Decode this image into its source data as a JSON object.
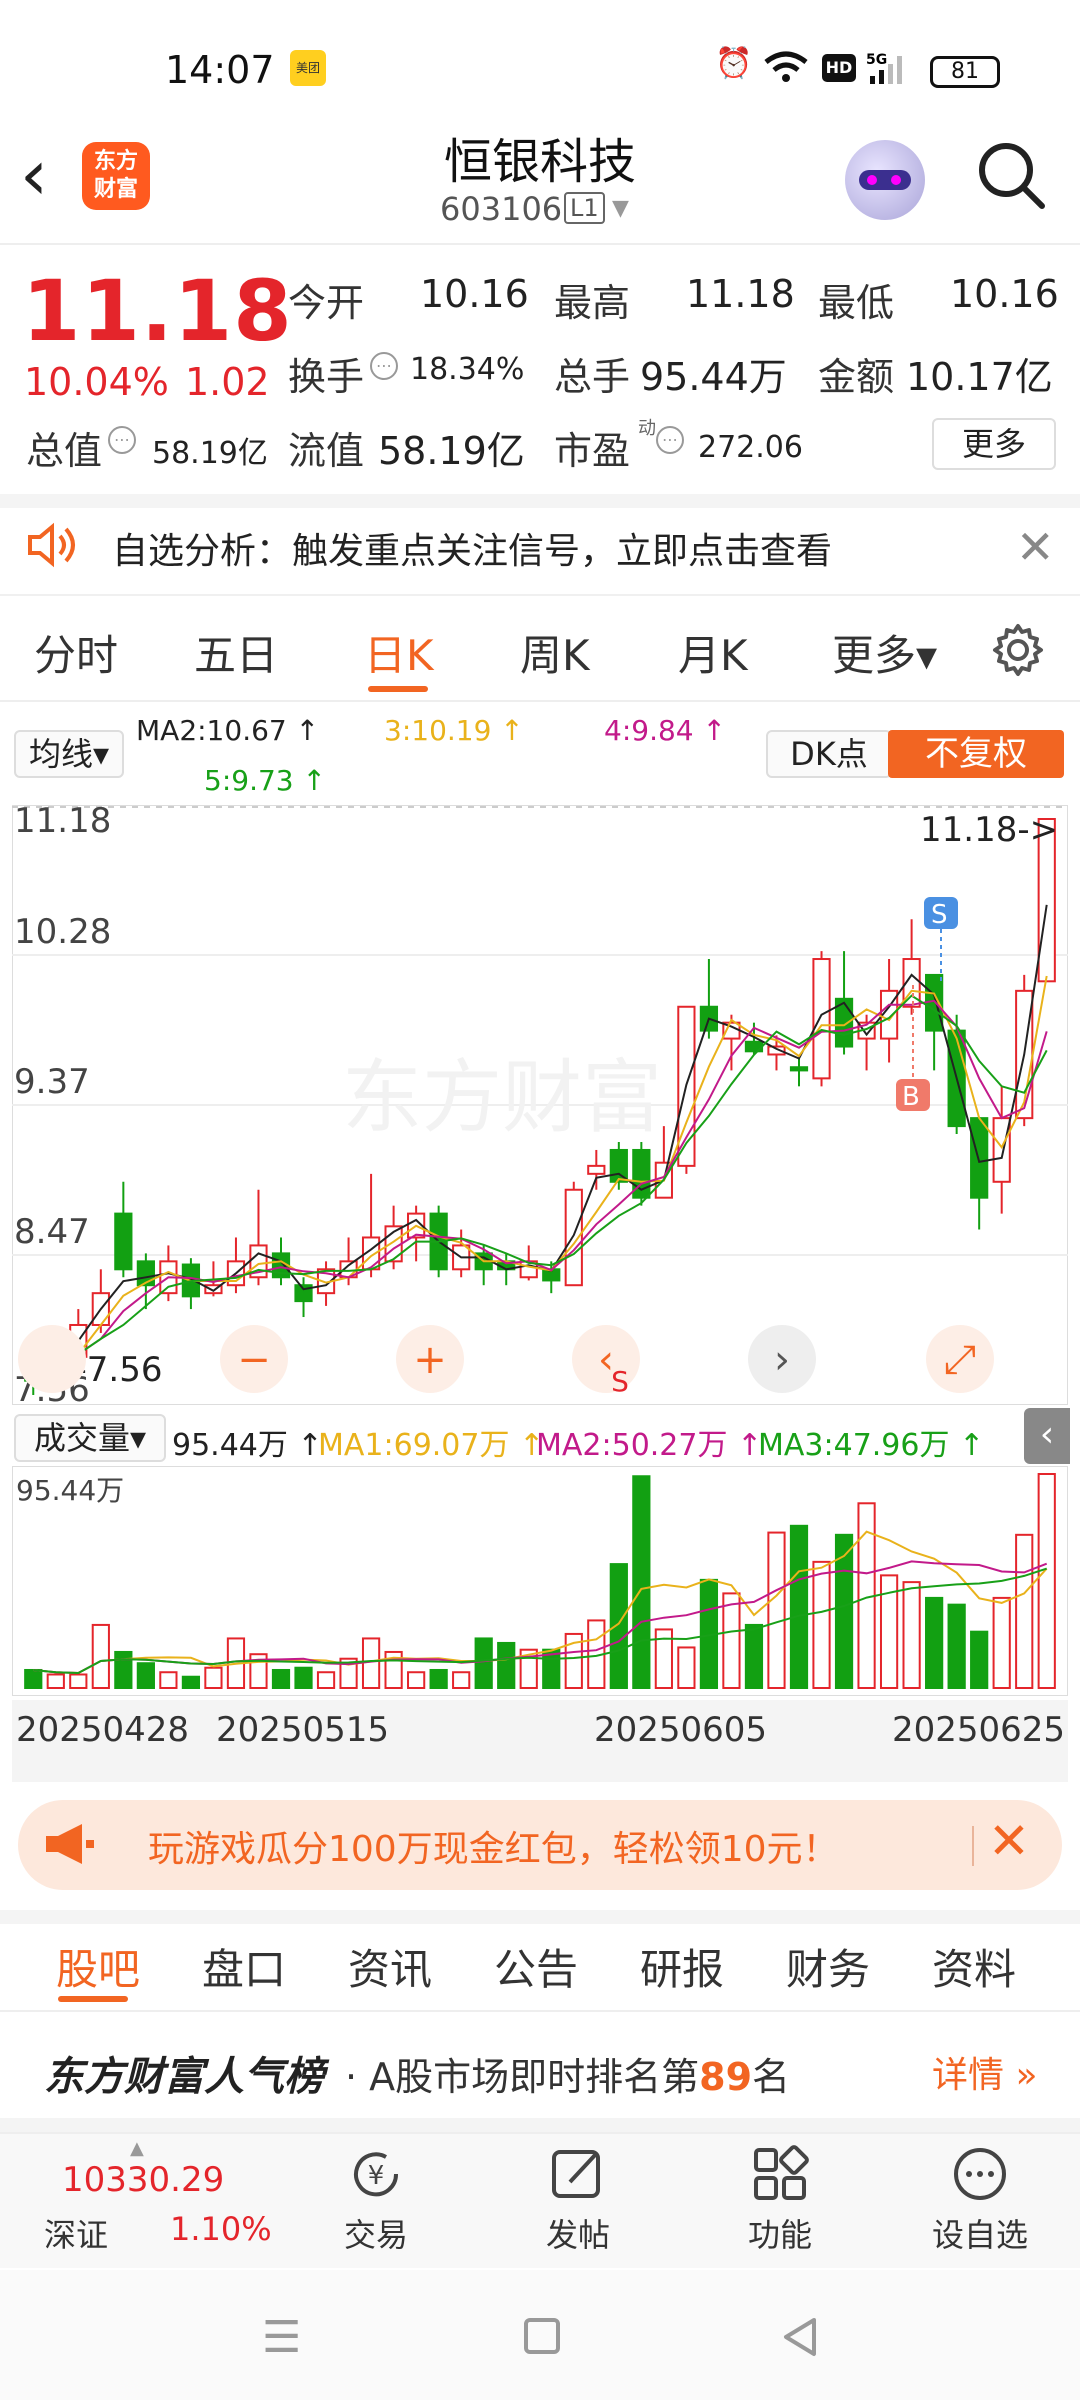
{
  "status_bar": {
    "time": "14:07",
    "app_badge": "美团",
    "battery": "81"
  },
  "header": {
    "back": "‹",
    "logo": "东方\n财富",
    "stock_name": "恒银科技",
    "stock_code": "603106",
    "level": "L1"
  },
  "quote": {
    "price": "11.18",
    "change_pct": "10.04%",
    "change": "1.02",
    "open_label": "今开",
    "open": "10.16",
    "high_label": "最高",
    "high": "11.18",
    "low_label": "最低",
    "low": "10.16",
    "turnover_label": "换手",
    "turnover": "18.34%",
    "volume_label": "总手",
    "volume": "95.44万",
    "amount_label": "金额",
    "amount": "10.17亿",
    "mktcap_label": "总值",
    "mktcap": "58.19亿",
    "float_label": "流值",
    "float_cap": "58.19亿",
    "pe_label": "市盈",
    "pe_sup": "动",
    "pe": "272.06",
    "more_button": "更多"
  },
  "analysis_banner": {
    "text": "自选分析：触发重点关注信号，立即点击查看"
  },
  "chart_tabs": [
    {
      "label": "分时"
    },
    {
      "label": "五日"
    },
    {
      "label": "日K"
    },
    {
      "label": "周K"
    },
    {
      "label": "月K"
    },
    {
      "label": "更多▾"
    }
  ],
  "ma_panel": {
    "selector": "均线▾",
    "ma2": "MA2:10.67 ↑",
    "ma3": "3:10.19 ↑",
    "ma4": "4:9.84 ↑",
    "ma5": "5:9.73 ↑",
    "dk_button": "DK点",
    "fuquan": "不复权"
  },
  "kline": {
    "y_labels": [
      "11.18",
      "10.28",
      "9.37",
      "8.47",
      "7.56"
    ],
    "max_marker": "11.18->",
    "min_marker": "<-7.56",
    "sell_tag": "S",
    "buy_tag": "B",
    "controls": [
      "−",
      "+",
      "‹",
      "›",
      "⤢"
    ],
    "control_sub": "S",
    "watermark": "东方财富",
    "colors": {
      "up": "#e4252b",
      "down": "#12a012"
    }
  },
  "volume_panel": {
    "selector": "成交量▾",
    "vol": "95.44万 ↑",
    "ma1": "MA1:69.07万 ↑",
    "ma2": "MA2:50.27万 ↑",
    "ma3": "MA3:47.96万 ↑",
    "y_label": "95.44万"
  },
  "dates": [
    "20250428",
    "20250515",
    "20250605",
    "20250625"
  ],
  "ad": {
    "text": "玩游戏瓜分100万现金红包，轻松领10元！"
  },
  "sub_tabs": [
    {
      "label": "股吧"
    },
    {
      "label": "盘口"
    },
    {
      "label": "资讯"
    },
    {
      "label": "公告"
    },
    {
      "label": "研报"
    },
    {
      "label": "财务"
    },
    {
      "label": "资料"
    }
  ],
  "rank": {
    "brand": "东方财富人气榜",
    "prefix": "· A股市场即时排名第",
    "number": "89",
    "suffix": "名",
    "detail": "详情 »"
  },
  "bottom_bar": {
    "index_value": "10330.29",
    "index_name": "深证",
    "index_pct": "1.10%",
    "items": [
      {
        "label": "交易"
      },
      {
        "label": "发帖"
      },
      {
        "label": "功能"
      },
      {
        "label": "设自选"
      }
    ]
  },
  "chart_data": {
    "type": "candlestick",
    "dates_shown": [
      "20250428",
      "20250515",
      "20250605",
      "20250625"
    ],
    "ylim": [
      7.56,
      11.18
    ],
    "candles": [
      [
        7.8,
        7.65,
        7.9,
        7.56
      ],
      [
        7.7,
        7.8,
        7.85,
        7.6
      ],
      [
        7.8,
        8.0,
        8.1,
        7.7
      ],
      [
        8.0,
        8.2,
        8.35,
        7.95
      ],
      [
        8.7,
        8.35,
        8.9,
        8.3
      ],
      [
        8.4,
        8.25,
        8.45,
        8.1
      ],
      [
        8.2,
        8.4,
        8.5,
        8.15
      ],
      [
        8.38,
        8.18,
        8.42,
        8.1
      ],
      [
        8.2,
        8.25,
        8.4,
        8.18
      ],
      [
        8.25,
        8.4,
        8.55,
        8.2
      ],
      [
        8.3,
        8.5,
        8.85,
        8.25
      ],
      [
        8.45,
        8.3,
        8.55,
        8.25
      ],
      [
        8.25,
        8.15,
        8.3,
        8.05
      ],
      [
        8.2,
        8.35,
        8.4,
        8.12
      ],
      [
        8.3,
        8.4,
        8.55,
        8.25
      ],
      [
        8.35,
        8.55,
        8.95,
        8.3
      ],
      [
        8.4,
        8.62,
        8.75,
        8.35
      ],
      [
        8.55,
        8.7,
        8.75,
        8.4
      ],
      [
        8.7,
        8.35,
        8.75,
        8.3
      ],
      [
        8.35,
        8.5,
        8.6,
        8.3
      ],
      [
        8.45,
        8.35,
        8.5,
        8.25
      ],
      [
        8.4,
        8.35,
        8.45,
        8.25
      ],
      [
        8.3,
        8.4,
        8.5,
        8.28
      ],
      [
        8.35,
        8.28,
        8.4,
        8.2
      ],
      [
        8.25,
        8.85,
        8.9,
        8.25
      ],
      [
        8.95,
        9.0,
        9.1,
        8.85
      ],
      [
        9.1,
        8.9,
        9.15,
        8.85
      ],
      [
        9.1,
        8.8,
        9.15,
        8.75
      ],
      [
        8.8,
        9.02,
        9.25,
        8.8
      ],
      [
        9.0,
        10.0,
        10.0,
        8.95
      ],
      [
        10.0,
        9.85,
        10.3,
        9.8
      ],
      [
        9.8,
        9.9,
        9.95,
        9.6
      ],
      [
        9.78,
        9.72,
        9.9,
        9.7
      ],
      [
        9.7,
        9.75,
        9.82,
        9.6
      ],
      [
        9.62,
        9.6,
        9.68,
        9.5
      ],
      [
        9.55,
        10.3,
        10.35,
        9.5
      ],
      [
        10.05,
        9.75,
        10.35,
        9.7
      ],
      [
        9.8,
        9.9,
        9.95,
        9.6
      ],
      [
        9.8,
        10.1,
        10.3,
        9.65
      ],
      [
        10.0,
        10.3,
        10.55,
        9.95
      ],
      [
        10.2,
        9.85,
        10.1,
        9.6
      ],
      [
        9.85,
        9.25,
        9.95,
        9.2
      ],
      [
        9.3,
        8.8,
        9.3,
        8.6
      ],
      [
        8.9,
        9.3,
        9.5,
        8.7
      ],
      [
        9.3,
        10.1,
        10.2,
        9.25
      ],
      [
        10.16,
        11.18,
        11.18,
        10.16
      ]
    ],
    "volume": [
      8,
      6,
      6,
      28,
      16,
      11,
      7,
      5,
      9,
      22,
      15,
      8,
      9,
      7,
      13,
      22,
      16,
      7,
      8,
      7,
      22,
      20,
      17,
      17,
      24,
      30,
      55,
      94,
      26,
      18,
      48,
      42,
      28,
      69,
      72,
      56,
      68,
      82,
      50,
      47,
      40,
      37,
      25,
      40,
      68,
      95
    ]
  }
}
